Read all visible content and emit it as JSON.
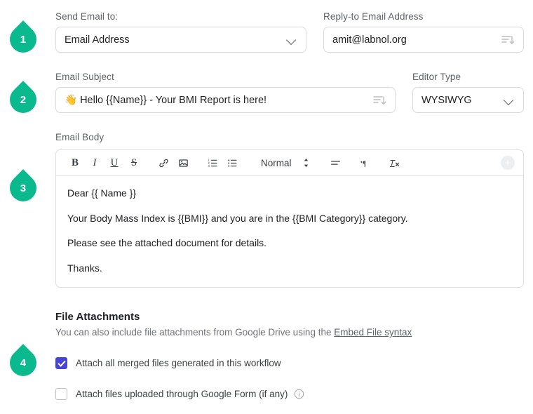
{
  "markers": [
    {
      "num": "1"
    },
    {
      "num": "2"
    },
    {
      "num": "3"
    },
    {
      "num": "4"
    }
  ],
  "fields": {
    "send_email_to": {
      "label": "Send Email to:",
      "value": "Email Address",
      "icon": "chevron-down-icon"
    },
    "reply_to": {
      "label": "Reply-to Email Address",
      "value": "amit@labnol.org",
      "icon": "list-dropdown-icon"
    },
    "email_subject": {
      "label": "Email Subject",
      "value": "👋 Hello {{Name}} - Your BMI Report is here!",
      "icon": "list-dropdown-icon"
    },
    "editor_type": {
      "label": "Editor Type",
      "value": "WYSIWYG",
      "icon": "chevron-down-icon",
      "options": [
        "WYSIWYG"
      ]
    },
    "email_body": {
      "label": "Email Body"
    }
  },
  "toolbar": {
    "bold": "B",
    "italic": "I",
    "underline": "U",
    "strike": "S",
    "link_icon": "link-icon",
    "image_icon": "image-icon",
    "ordered_list_icon": "ordered-list-icon",
    "bullet_list_icon": "bullet-list-icon",
    "format_select": "Normal",
    "updown_icon": "up-down-arrows-icon",
    "align_icon": "align-icon",
    "direction_icon": "text-direction-icon",
    "clear_format_icon": "clear-formatting-icon",
    "add_icon": "plus-circle-icon"
  },
  "body_paragraphs": [
    "Dear {{ Name }}",
    "Your Body Mass Index is {{BMI}} and you are in the {{BMI Category}} category.",
    "Please see the attached document for details.",
    "Thanks."
  ],
  "attachments": {
    "title": "File Attachments",
    "subtitle_before": "You can also include file attachments from Google Drive using the ",
    "subtitle_link": "Embed File syntax",
    "checkbox_merged": {
      "label": "Attach all merged files generated in this workflow",
      "checked": true
    },
    "checkbox_form": {
      "label": "Attach files uploaded through Google Form (if any)",
      "checked": false,
      "info_icon": "info-circle-icon"
    }
  },
  "colors": {
    "marker_teal": "#0ab98e",
    "checkbox_checked": "#4744d6",
    "border": "#d8dade",
    "label_text": "#5f6368"
  }
}
